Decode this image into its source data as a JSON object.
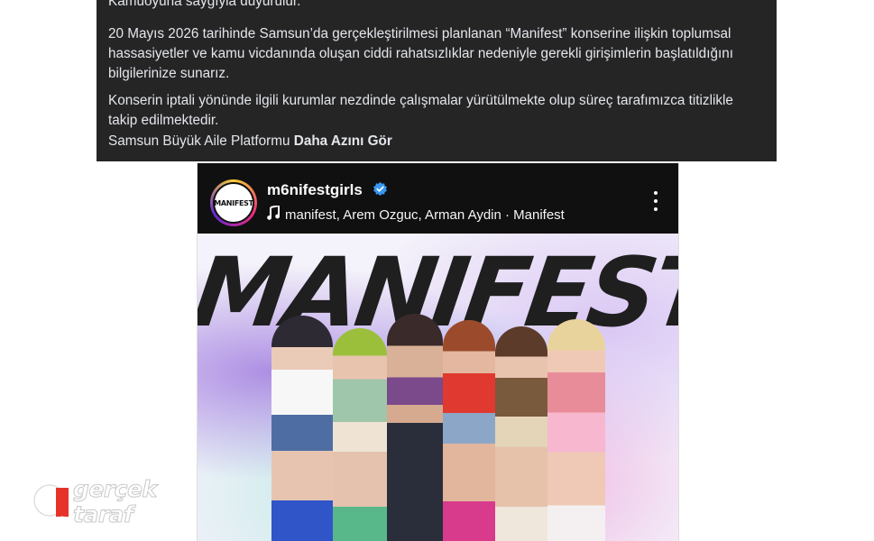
{
  "post": {
    "line_top": "Kamuoyuna saygıyla duyurulur.",
    "paragraph1": "20 Mayıs 2026 tarihinde Samsun’da gerçekleştirilmesi planlanan “Manifest” konserine ilişkin toplumsal hassasiyetler ve kamu vicdanında oluşan ciddi rahatsızlıklar nedeniyle gerekli girişimlerin başlatıldığını bilgilerinize sunarız.",
    "paragraph2": "Konserin iptali yönünde ilgili kurumlar nezdinde çalışmalar yürütülmekte olup süreç tarafımızca titizlikle takip edilmektedir.",
    "signature": "Samsun Büyük Aile Platformu",
    "see_more": "Daha Azını Gör"
  },
  "instagram": {
    "avatar_text": "MANIFEST",
    "username": "m6nifestgirls",
    "audio": "manifest, Arem Ozguc, Arman Aydin · Manifest",
    "image_wordmark": "MANIFEST"
  },
  "watermark": {
    "line1": "gerçek",
    "line2": "taraf",
    "badge": "g"
  },
  "colors": {
    "panel_bg": "#252526",
    "ig_header_bg": "#101010",
    "verified_blue": "#3897f0",
    "watermark_red": "#e63329"
  }
}
